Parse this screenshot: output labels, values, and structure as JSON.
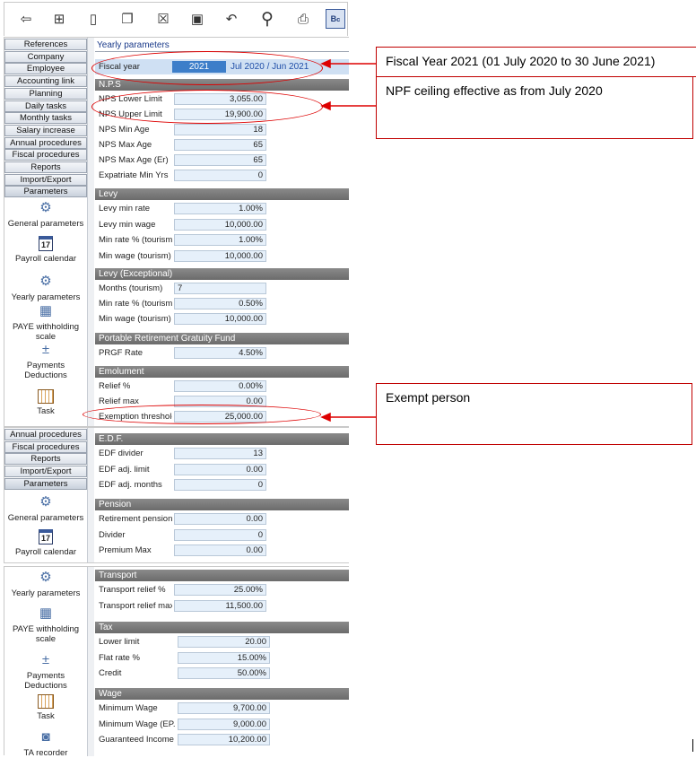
{
  "toolbar": {
    "icons": [
      "back-arrow-icon",
      "tree-icon",
      "document-icon",
      "copy-icon",
      "delete-icon",
      "save-icon",
      "undo-icon",
      "search-icon",
      "print-icon",
      "calculator-icon"
    ]
  },
  "nav_top": [
    "References",
    "Company",
    "Employee",
    "Accounting link",
    "Planning",
    "Daily tasks",
    "Monthly tasks",
    "Salary increase",
    "Annual procedures",
    "Fiscal procedures",
    "Reports",
    "Import/Export",
    "Parameters"
  ],
  "items_top": [
    "General parameters",
    "Payroll calendar",
    "Yearly parameters",
    "PAYE withholding scale",
    "Payments Deductions",
    "Task"
  ],
  "nav_mid": [
    "Annual procedures",
    "Fiscal procedures",
    "Reports",
    "Import/Export",
    "Parameters"
  ],
  "items_mid": [
    "General parameters",
    "Payroll calendar"
  ],
  "items_bottom": [
    "Yearly parameters",
    "PAYE withholding scale",
    "Payments Deductions",
    "Task",
    "TA recorder"
  ],
  "calendar_day": "17",
  "panel_title": "Yearly parameters",
  "fiscal": {
    "label": "Fiscal year",
    "year": "2021",
    "period": "Jul 2020 / Jun 2021"
  },
  "sections": {
    "nps": {
      "title": "N.P.S",
      "rows": [
        {
          "label": "NPS Lower Limit",
          "value": "3,055.00"
        },
        {
          "label": "NPS Upper Limit",
          "value": "19,900.00"
        },
        {
          "label": "NPS Min Age",
          "value": "18"
        },
        {
          "label": "NPS Max Age",
          "value": "65"
        },
        {
          "label": "NPS Max Age (Er)",
          "value": "65"
        },
        {
          "label": "Expatriate Min Yrs",
          "value": "0"
        }
      ]
    },
    "levy": {
      "title": "Levy",
      "rows": [
        {
          "label": "Levy min rate",
          "value": "1.00%"
        },
        {
          "label": "Levy min wage",
          "value": "10,000.00"
        },
        {
          "label": "Min rate % (tourism)",
          "value": "1.00%"
        },
        {
          "label": "Min wage (tourism)",
          "value": "10,000.00"
        }
      ]
    },
    "levy_ex": {
      "title": "Levy (Exceptional)",
      "rows": [
        {
          "label": "Months (tourism)",
          "value": "7"
        },
        {
          "label": "Min rate % (tourism)",
          "value": "0.50%"
        },
        {
          "label": "Min wage (tourism)",
          "value": "10,000.00"
        }
      ]
    },
    "prgf": {
      "title": "Portable Retirement Gratuity Fund",
      "rows": [
        {
          "label": "PRGF Rate",
          "value": "4.50%"
        }
      ]
    },
    "emolument": {
      "title": "Emolument",
      "rows": [
        {
          "label": "Relief %",
          "value": "0.00%"
        },
        {
          "label": "Relief max",
          "value": "0.00"
        },
        {
          "label": "Exemption thresholc",
          "value": "25,000.00"
        }
      ]
    },
    "edf": {
      "title": "E.D.F.",
      "rows": [
        {
          "label": "EDF divider",
          "value": "13"
        },
        {
          "label": "EDF adj. limit",
          "value": "0.00"
        },
        {
          "label": "EDF adj. months",
          "value": "0"
        }
      ]
    },
    "pension": {
      "title": "Pension",
      "rows": [
        {
          "label": "Retirement pension",
          "value": "0.00"
        },
        {
          "label": "Divider",
          "value": "0"
        },
        {
          "label": "Premium Max",
          "value": "0.00"
        }
      ]
    },
    "transport": {
      "title": "Transport",
      "rows": [
        {
          "label": "Transport relief %",
          "value": "25.00%"
        },
        {
          "label": "Transport relief max",
          "value": "11,500.00"
        }
      ]
    },
    "tax": {
      "title": "Tax",
      "rows": [
        {
          "label": "Lower limit",
          "value": "20.00"
        },
        {
          "label": "Flat rate %",
          "value": "15.00%"
        },
        {
          "label": "Credit",
          "value": "50.00%"
        }
      ]
    },
    "wage": {
      "title": "Wage",
      "rows": [
        {
          "label": "Minimum Wage",
          "value": "9,700.00"
        },
        {
          "label": "Minimum Wage (EP.",
          "value": "9,000.00"
        },
        {
          "label": "Guaranteed Income",
          "value": "10,200.00"
        }
      ]
    }
  },
  "callouts": {
    "fiscal": "Fiscal Year 2021 (01 July 2020 to 30 June 2021)",
    "npf": "NPF ceiling effective as from July 2020",
    "exempt": "Exempt person"
  },
  "colors": {
    "annotation": "#d00000",
    "field_bg": "#e6f0fa",
    "section_header": "#737373",
    "fiscal_bg": "#3d7ec9"
  }
}
